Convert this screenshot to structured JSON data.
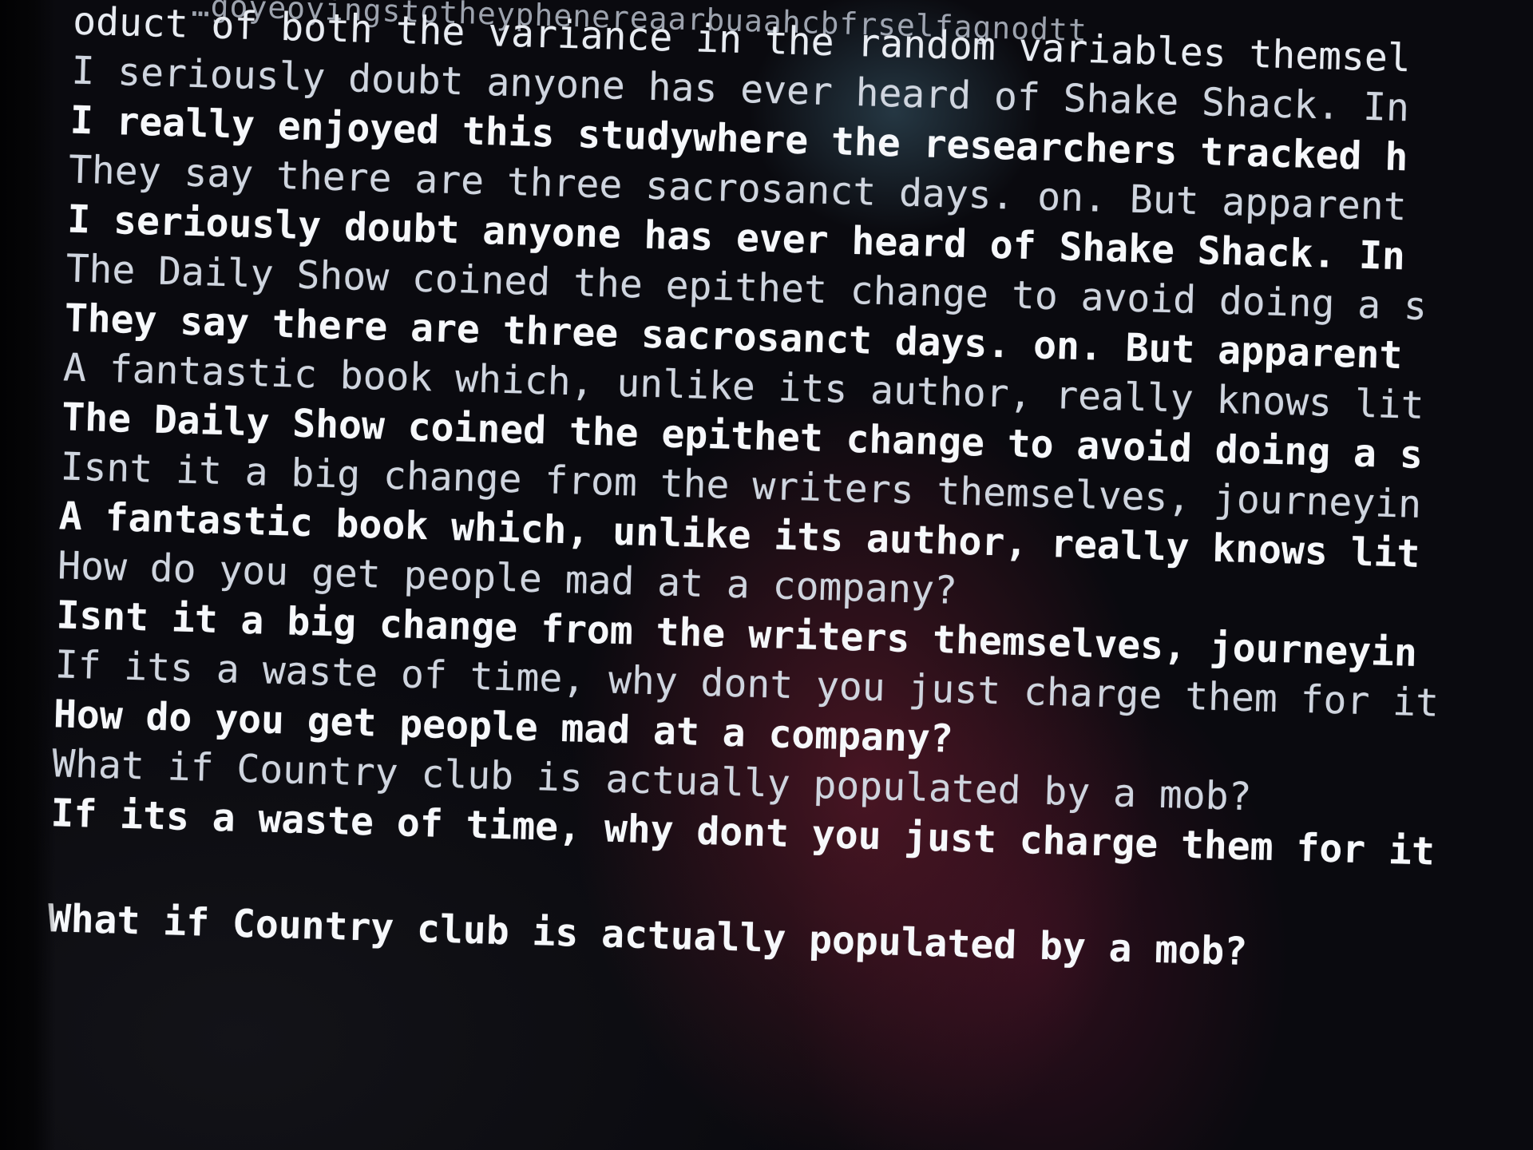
{
  "terminal": {
    "header_fragment": "…goyeoyingstotheyphenereaarbuaahcbfrselfagnodtt",
    "lines": [
      "oduct of both the variance in the random variables themsel",
      "I seriously doubt anyone has ever heard of Shake Shack. In",
      "I really enjoyed this studywhere the researchers tracked h",
      "They say there are three sacrosanct days. on. But apparent",
      "I seriously doubt anyone has ever heard of Shake Shack. In",
      "The Daily Show coined the epithet change to avoid doing a s",
      "They say there are three sacrosanct days. on. But apparent",
      "A fantastic book which, unlike its author, really knows lit",
      "The Daily Show coined the epithet change to avoid doing a s",
      "Isnt it a big change from the writers themselves, journeyin",
      "A fantastic book which, unlike its author, really knows lit",
      "How do you get people mad at a company?",
      "Isnt it a big change from the writers themselves, journeyin",
      "If its a waste of time, why dont you just charge them for it",
      "How do you get people mad at a company?",
      "What if Country club is actually populated by a mob?",
      "If its a waste of time, why dont you just charge them for it",
      "What if Country club is actually populated by a mob?"
    ]
  }
}
